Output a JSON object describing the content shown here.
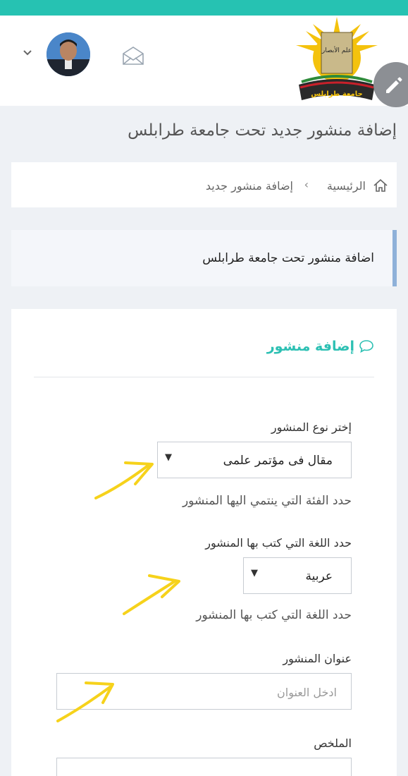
{
  "header": {
    "avatar_alt": "user-avatar",
    "logo_text_top": "علم الأبصار",
    "logo_text_bottom": "جامعة طرابلس"
  },
  "page_title": "إضافة منشور جديد تحت جامعة طرابلس",
  "breadcrumb": {
    "home": "الرئيسية",
    "separator": "›",
    "current": "إضافة منشور جديد"
  },
  "notice": "اضافة منشور تحت جامعة طرابلس",
  "form": {
    "title": "إضافة منشور",
    "type_label": "إختر نوع المنشور",
    "type_value": "مقال فى مؤتمر علمى",
    "type_help": "حدد الفئة التي ينتمي اليها المنشور",
    "lang_label": "حدد اللغة التي كتب بها المنشور",
    "lang_value": "عربية",
    "lang_help": "حدد اللغة التي كتب بها المنشور",
    "title_label": "عنوان المنشور",
    "title_placeholder": "ادخل العنوان",
    "summary_label": "الملخص"
  },
  "colors": {
    "accent": "#26c2b2",
    "notice_border": "#8eb1d9",
    "annotation": "#f6d21b"
  }
}
